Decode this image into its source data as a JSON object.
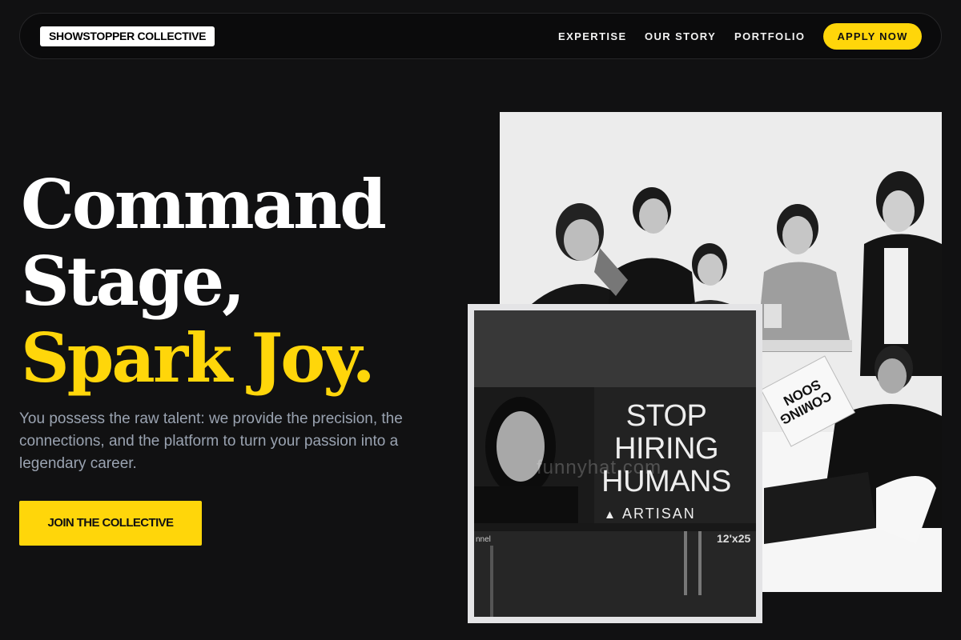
{
  "nav": {
    "logo": "SHOWSTOPPER COLLECTIVE",
    "links": [
      "EXPERTISE",
      "OUR STORY",
      "PORTFOLIO"
    ],
    "cta": "APPLY NOW"
  },
  "hero": {
    "headline_line1": "Command",
    "headline_line2": "Stage,",
    "headline_accent": "Spark Joy.",
    "lead": "You possess the raw talent: we provide the precision, the connections, and the platform to turn your passion into a legendary career.",
    "cta": "JOIN THE COLLECTIVE"
  },
  "images": {
    "team_photo": {
      "sign_text_line1": "COMING",
      "sign_text_line2": "SOON"
    },
    "billboard_photo": {
      "headline_lines": [
        "STOP",
        "HIRING",
        "HUMANS"
      ],
      "brand": "ARTISAN",
      "size_label": "12'x25",
      "channel_label": "nnel",
      "watermark": "funnyhat.com"
    }
  },
  "colors": {
    "background": "#111112",
    "accent": "#ffd60a",
    "muted_text": "#9aa3b1"
  }
}
